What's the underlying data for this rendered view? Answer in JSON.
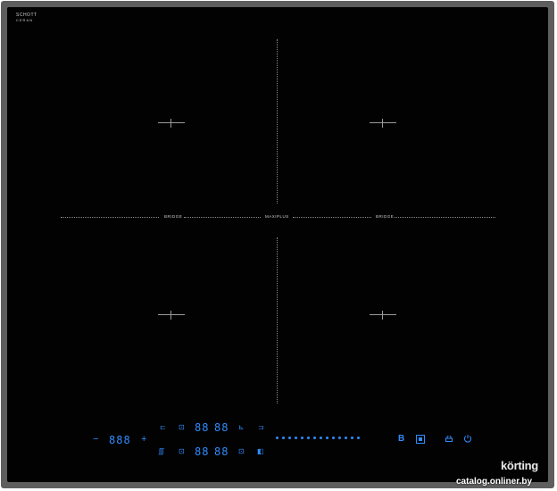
{
  "brand": {
    "glass_maker_line1": "SCHOTT",
    "glass_maker_line2": "CERAN",
    "logo": "körting"
  },
  "zones": {
    "left_label": "BRIDGE",
    "center_label": "MAXIPLUS",
    "right_label": "BRIDGE"
  },
  "controls": {
    "minus": "−",
    "timer_digits": "888",
    "plus": "+",
    "row1_left_digits": "88",
    "row1_right_digits": "88",
    "row2_left_digits": "88",
    "row2_right_digits": "88",
    "heat_symbol": "ʃʃʃ",
    "boost_label": "B",
    "slider_dot_count": 14,
    "accent_color": "#2f8cff"
  },
  "watermark": "catalog.onliner.by"
}
